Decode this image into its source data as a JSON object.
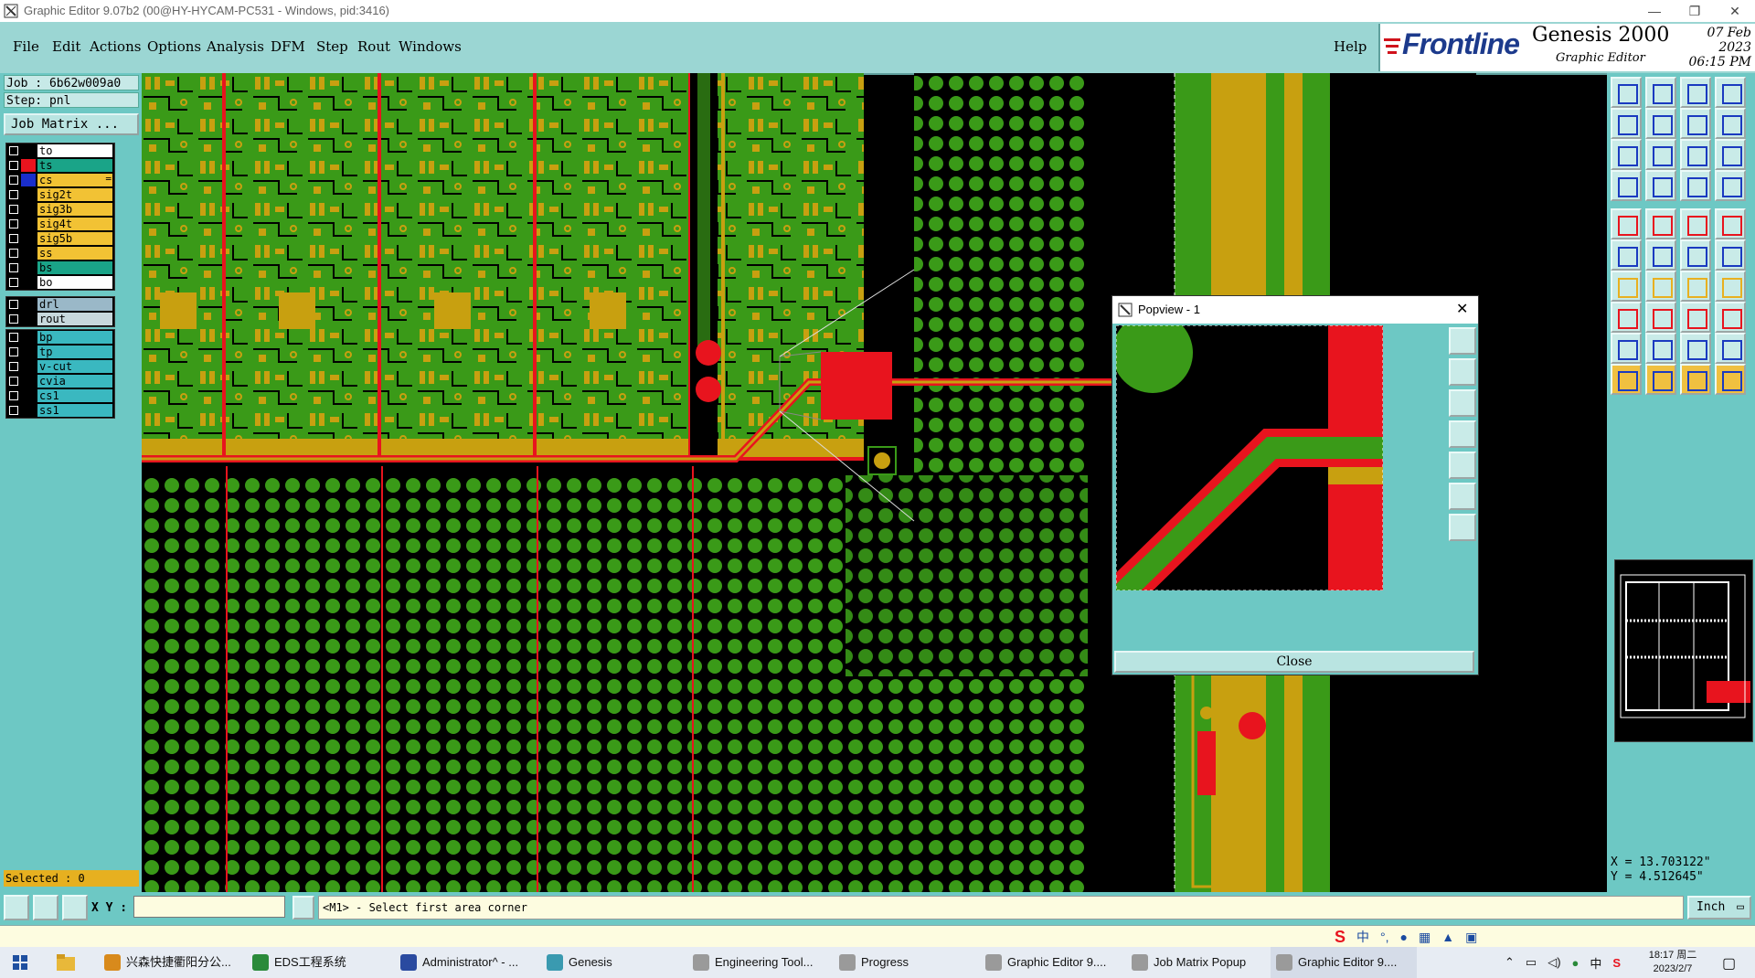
{
  "window": {
    "title": "Graphic Editor 9.07b2 (00@HY-HYCAM-PC531 - Windows, pid:3416)",
    "controls": [
      "—",
      "❐",
      "✕"
    ]
  },
  "menu": {
    "items": [
      "File",
      "Edit",
      "Actions",
      "Options",
      "Analysis",
      "DFM",
      "Step",
      "Rout",
      "Windows"
    ],
    "help": "Help"
  },
  "brand": {
    "logo_prefix": "F",
    "logo_rest": "rontline",
    "product": "Genesis 2000",
    "subtitle": "Graphic Editor",
    "date": "07 Feb 2023",
    "time": "06:15 PM"
  },
  "job": {
    "job_label": "Job  :  6b62w009a0",
    "step_label": "Step: pnl",
    "matrix_button": "Job Matrix ..."
  },
  "layer_groups": [
    [
      {
        "name": "to",
        "swatch": "#000000",
        "bg": "#ffffff"
      },
      {
        "name": "ts",
        "swatch": "#e8141e",
        "bg": "#1aa488"
      },
      {
        "name": "cs",
        "swatch": "#1a2ecc",
        "bg": "#f2c234",
        "marker": "="
      },
      {
        "name": "sig2t",
        "swatch": "#000000",
        "bg": "#f2c234"
      },
      {
        "name": "sig3b",
        "swatch": "#000000",
        "bg": "#f2c234"
      },
      {
        "name": "sig4t",
        "swatch": "#000000",
        "bg": "#f2c234"
      },
      {
        "name": "sig5b",
        "swatch": "#000000",
        "bg": "#f2c234"
      },
      {
        "name": "ss",
        "swatch": "#000000",
        "bg": "#f2c234"
      },
      {
        "name": "bs",
        "swatch": "#000000",
        "bg": "#1aa488"
      },
      {
        "name": "bo",
        "swatch": "#000000",
        "bg": "#ffffff"
      }
    ],
    [
      {
        "name": "drl",
        "swatch": "#000000",
        "bg": "#9ab8c8"
      },
      {
        "name": "rout",
        "swatch": "#000000",
        "bg": "#c8d8dc"
      }
    ],
    [
      {
        "name": "bp",
        "swatch": "#000000",
        "bg": "#3ab8c0"
      },
      {
        "name": "tp",
        "swatch": "#000000",
        "bg": "#3ab8c0"
      },
      {
        "name": "v-cut",
        "swatch": "#000000",
        "bg": "#3ab8c0"
      },
      {
        "name": "cvia",
        "swatch": "#000000",
        "bg": "#3ab8c0"
      },
      {
        "name": "cs1",
        "swatch": "#000000",
        "bg": "#3ab8c0"
      },
      {
        "name": "ss1",
        "swatch": "#000000",
        "bg": "#3ab8c0"
      }
    ]
  ],
  "selected": "Selected : 0",
  "coords": {
    "x": "X = 13.703122\"",
    "y": "Y =  4.512645\""
  },
  "bottom": {
    "xy_label": "X Y :",
    "xy_value": "",
    "prompt": "<M1> - Select first area corner",
    "units": "Inch"
  },
  "popview": {
    "title": "Popview - 1",
    "close": "Close"
  },
  "ime": [
    "中",
    "°,"
  ],
  "taskbar": {
    "items": [
      {
        "label": "兴森快捷衢阳分公...",
        "color": "#d88a1c"
      },
      {
        "label": "EDS工程系统",
        "color": "#2a8a3a"
      },
      {
        "label": "Administrator^ - ...",
        "color": "#2a4aa0"
      },
      {
        "label": "Genesis",
        "color": "#3a9ab0"
      },
      {
        "label": "Engineering Tool...",
        "color": "#9a9a9a"
      },
      {
        "label": "Progress",
        "color": "#9a9a9a"
      },
      {
        "label": "Graphic Editor 9....",
        "color": "#9a9a9a"
      },
      {
        "label": "Job Matrix Popup",
        "color": "#9a9a9a"
      },
      {
        "label": "Graphic Editor 9....",
        "color": "#9a9a9a"
      }
    ],
    "tray_lang": "中",
    "clock_time": "18:17 周二",
    "clock_date": "2023/2/7"
  },
  "colors": {
    "panel": "#6dc8c4",
    "copper": "#c8a010",
    "substrate": "#3a9a18",
    "red": "#e8141e"
  }
}
